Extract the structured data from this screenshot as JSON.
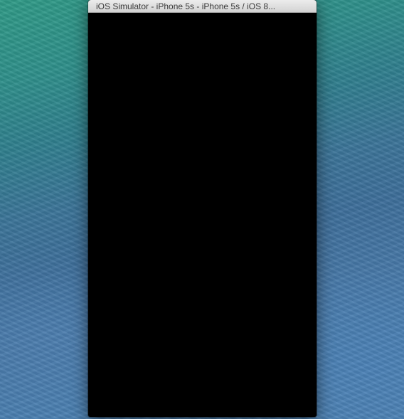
{
  "desktop": {
    "wallpaper": "ocean-wave-wallpaper"
  },
  "simulator_window": {
    "title": "iOS Simulator - iPhone 5s - iPhone 5s / iOS 8...",
    "screen_color": "#000000"
  }
}
